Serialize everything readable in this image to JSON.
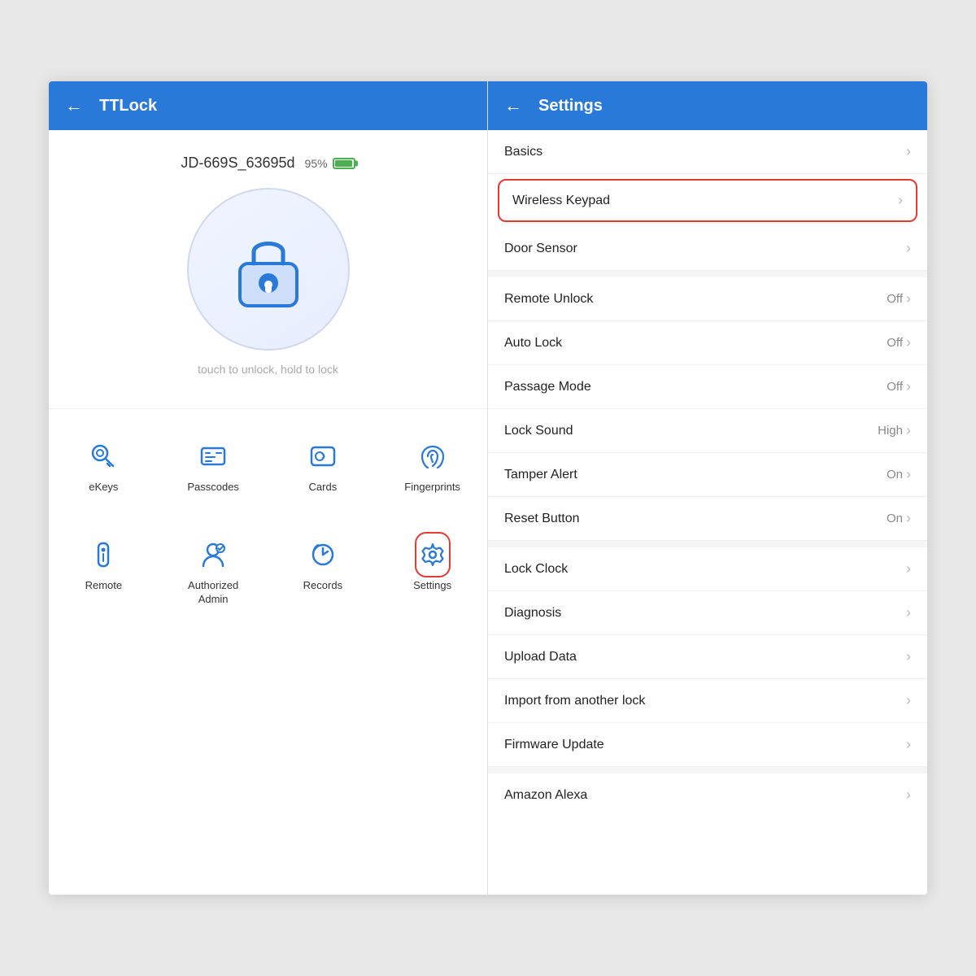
{
  "left_panel": {
    "header": {
      "back_label": "←",
      "title": "TTLock"
    },
    "device": {
      "name": "JD-669S_63695d",
      "battery_percent": "95%",
      "touch_hint": "touch to unlock, hold to lock"
    },
    "grid_row1": [
      {
        "id": "ekeys",
        "label": "eKeys"
      },
      {
        "id": "passcodes",
        "label": "Passcodes"
      },
      {
        "id": "cards",
        "label": "Cards"
      },
      {
        "id": "fingerprints",
        "label": "Fingerprints"
      }
    ],
    "grid_row2": [
      {
        "id": "remote",
        "label": "Remote"
      },
      {
        "id": "authorized-admin",
        "label": "Authorized\nAdmin"
      },
      {
        "id": "records",
        "label": "Records"
      },
      {
        "id": "settings",
        "label": "Settings"
      }
    ]
  },
  "right_panel": {
    "header": {
      "back_label": "←",
      "title": "Settings"
    },
    "items": [
      {
        "id": "basics",
        "label": "Basics",
        "value": "",
        "highlighted": false
      },
      {
        "id": "wireless-keypad",
        "label": "Wireless Keypad",
        "value": "",
        "highlighted": true
      },
      {
        "id": "door-sensor",
        "label": "Door Sensor",
        "value": "",
        "highlighted": false
      },
      {
        "id": "remote-unlock",
        "label": "Remote Unlock",
        "value": "Off",
        "highlighted": false
      },
      {
        "id": "auto-lock",
        "label": "Auto Lock",
        "value": "Off",
        "highlighted": false
      },
      {
        "id": "passage-mode",
        "label": "Passage Mode",
        "value": "Off",
        "highlighted": false
      },
      {
        "id": "lock-sound",
        "label": "Lock Sound",
        "value": "High",
        "highlighted": false
      },
      {
        "id": "tamper-alert",
        "label": "Tamper Alert",
        "value": "On",
        "highlighted": false
      },
      {
        "id": "reset-button",
        "label": "Reset Button",
        "value": "On",
        "highlighted": false
      },
      {
        "id": "lock-clock",
        "label": "Lock Clock",
        "value": "",
        "highlighted": false
      },
      {
        "id": "diagnosis",
        "label": "Diagnosis",
        "value": "",
        "highlighted": false
      },
      {
        "id": "upload-data",
        "label": "Upload Data",
        "value": "",
        "highlighted": false
      },
      {
        "id": "import-another",
        "label": "Import from another lock",
        "value": "",
        "highlighted": false
      },
      {
        "id": "firmware-update",
        "label": "Firmware Update",
        "value": "",
        "highlighted": false
      },
      {
        "id": "amazon-alexa",
        "label": "Amazon Alexa",
        "value": "",
        "highlighted": false
      }
    ]
  }
}
